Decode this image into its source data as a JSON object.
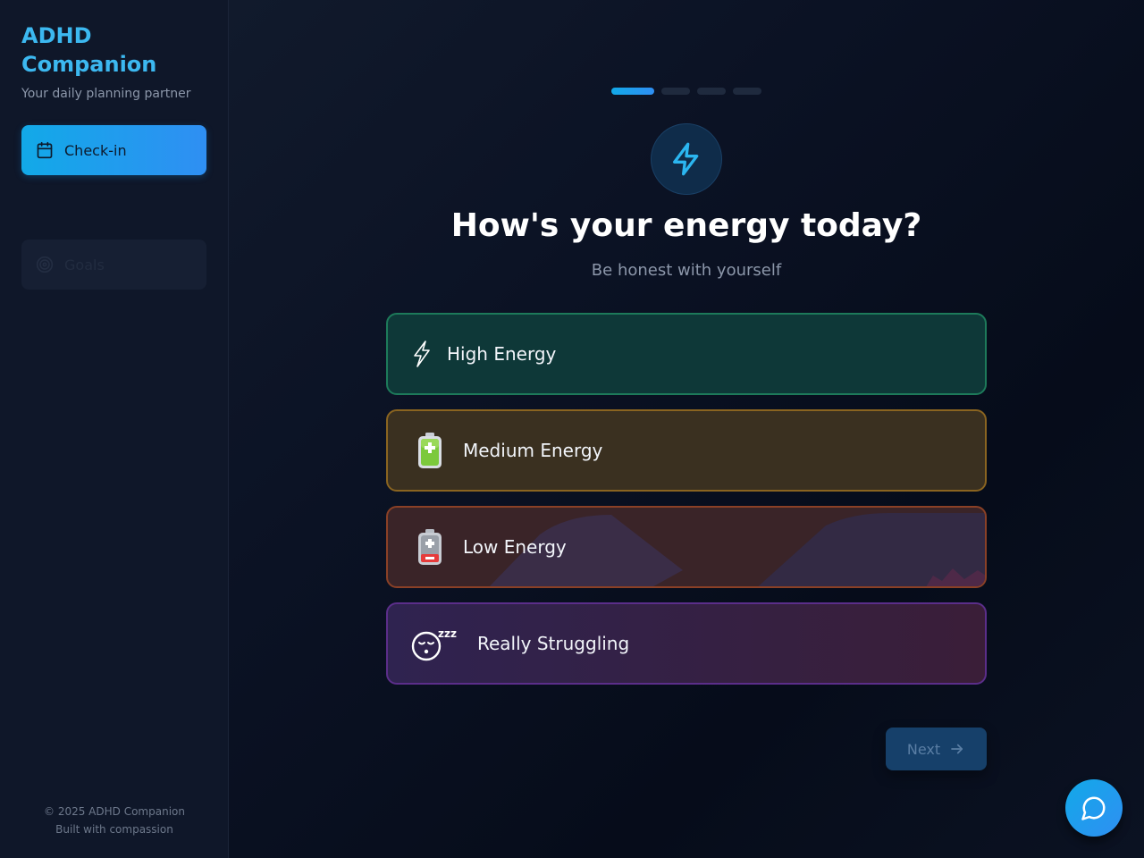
{
  "app": {
    "title": "ADHD Companion",
    "tagline": "Your daily planning partner"
  },
  "sidebar": {
    "items": [
      {
        "label": "Check-in",
        "icon": "calendar-icon",
        "active": true
      },
      {
        "label": "Goals",
        "icon": "target-icon",
        "active": false
      }
    ],
    "footer": {
      "copyright": "© 2025 ADHD Companion",
      "note": "Built with compassion"
    }
  },
  "main": {
    "progress": {
      "current_step": 1,
      "total_steps": 4
    },
    "header_icon": "lightning-bolt-icon",
    "title": "How's your energy today?",
    "subtitle": "Be honest with yourself",
    "options": [
      {
        "label": "High Energy",
        "emoji": "⚡",
        "color": "#1d7a5a"
      },
      {
        "label": "Medium Energy",
        "emoji": "🔋",
        "color": "#8a6420"
      },
      {
        "label": "Low Energy",
        "emoji": "🪫",
        "color": "#8a4026"
      },
      {
        "label": "Really Struggling",
        "emoji": "😴",
        "color": "#5b2e8a"
      }
    ],
    "next_label": "Next"
  },
  "colors": {
    "accent": "#12a9e8",
    "brand": "#3cb8f0",
    "background": "#0a1020"
  }
}
